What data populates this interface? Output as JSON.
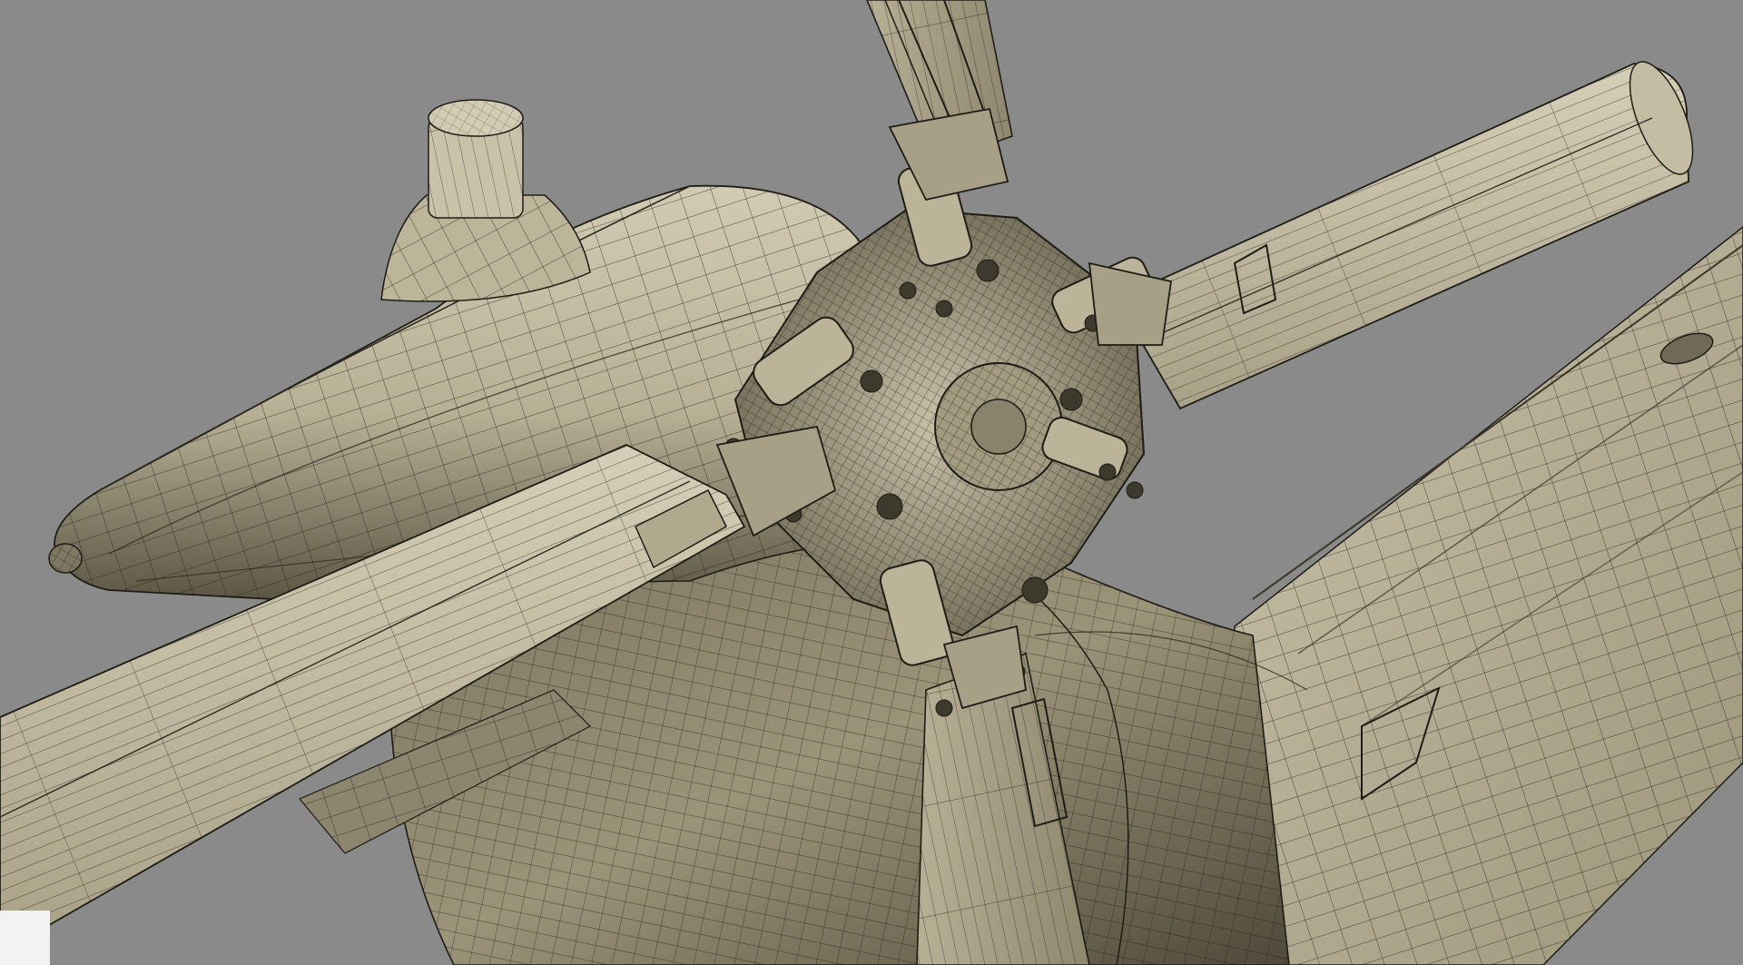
{
  "scene": {
    "subject": "helicopter-main-rotor-wireframe-render",
    "colors": {
      "background": "#8a8a8a",
      "surface_light": "#cfc8b0",
      "surface_mid": "#b3ab90",
      "surface_dark": "#6b654f",
      "wire": "#1e1c16",
      "corner_patch": "#f2f2f2"
    }
  }
}
